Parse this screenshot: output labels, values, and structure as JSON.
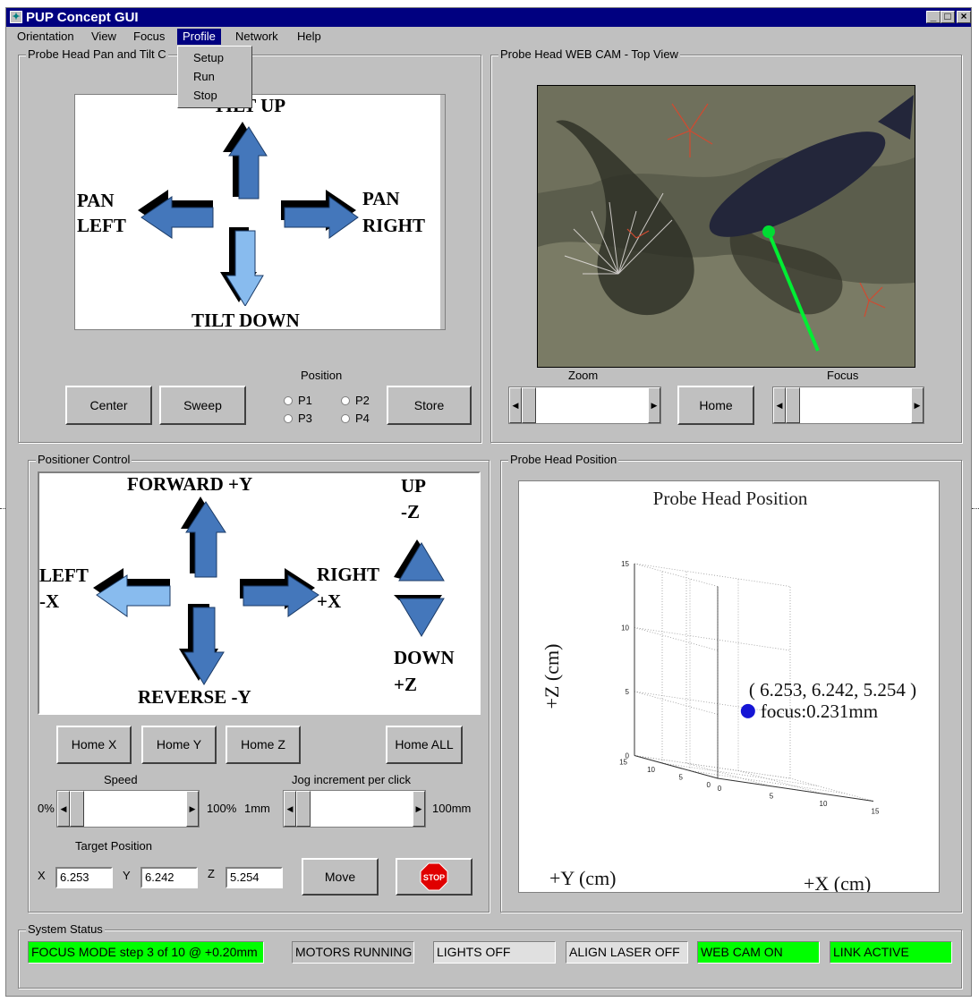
{
  "window": {
    "title": "PUP Concept GUI"
  },
  "menus": [
    "Orientation",
    "View",
    "Focus",
    "Profile",
    "Network",
    "Help"
  ],
  "profile_menu": [
    "Setup",
    "Run",
    "Stop"
  ],
  "pan_tilt": {
    "group_label": "Probe Head Pan and Tilt C",
    "tilt_up": "TILT UP",
    "tilt_down": "TILT DOWN",
    "pan_left": [
      "PAN",
      "LEFT"
    ],
    "pan_right": [
      "PAN",
      "RIGHT"
    ],
    "center_label": "Center",
    "sweep_label": "Sweep",
    "position_label": "Position",
    "presets": [
      "P1",
      "P2",
      "P3",
      "P4"
    ],
    "store_label": "Store"
  },
  "webcam": {
    "group_label": "Probe Head WEB CAM - Top View",
    "zoom_label": "Zoom",
    "focus_label": "Focus",
    "home_label": "Home"
  },
  "positioner": {
    "group_label": "Positioner Control",
    "forward": "FORWARD +Y",
    "reverse": "REVERSE -Y",
    "left": [
      "LEFT",
      "-X"
    ],
    "right": [
      "RIGHT",
      "+X"
    ],
    "up": [
      "UP",
      "-Z"
    ],
    "down": [
      "DOWN",
      "+Z"
    ],
    "home_buttons": [
      "Home X",
      "Home Y",
      "Home Z"
    ],
    "home_all_label": "Home ALL",
    "speed_label": "Speed",
    "speed_min": "0%",
    "speed_max": "100%",
    "jog_label": "Jog increment per click",
    "jog_min": "1mm",
    "jog_max": "100mm",
    "target_label": "Target Position",
    "target": {
      "x_label": "X",
      "y_label": "Y",
      "z_label": "Z",
      "x": "6.253",
      "y": "6.242",
      "z": "5.254"
    },
    "move_label": "Move",
    "stop_label": "STOP"
  },
  "probe_position": {
    "group_label": "Probe Head Position",
    "plot_title": "Probe Head Position",
    "ylabel": "+Y (cm)",
    "xlabel": "+X (cm)",
    "zlabel": "+Z (cm)",
    "annotation": "( 6.253, 6.242, 5.254 )",
    "focus_text": "focus:0.231mm",
    "z_ticks": [
      "0",
      "5",
      "10",
      "15"
    ],
    "y_ticks": [
      "15",
      "10",
      "5",
      "0"
    ],
    "x_ticks": [
      "0",
      "5",
      "10",
      "15"
    ]
  },
  "chart_data": {
    "type": "scatter",
    "title": "Probe Head Position",
    "xlabel": "+X (cm)",
    "ylabel": "+Y (cm)",
    "zlabel": "+Z (cm)",
    "xlim": [
      0,
      15
    ],
    "ylim": [
      0,
      15
    ],
    "zlim": [
      0,
      15
    ],
    "grid": true,
    "points": [
      {
        "x": 6.253,
        "y": 6.242,
        "z": 5.254
      }
    ],
    "annotations": [
      "( 6.253, 6.242, 5.254 )",
      "focus:0.231mm"
    ]
  },
  "system_status": {
    "group_label": "System Status",
    "items": [
      {
        "text": "FOCUS MODE step 3 of 10 @ +0.20mm",
        "color": "#00ff00"
      },
      {
        "text": "MOTORS RUNNING",
        "color": "#c0c0c0"
      },
      {
        "text": "LIGHTS OFF",
        "color": "#e0e0e0"
      },
      {
        "text": "ALIGN LASER OFF",
        "color": "#e0e0e0"
      },
      {
        "text": "WEB CAM ON",
        "color": "#00ff00"
      },
      {
        "text": "LINK ACTIVE",
        "color": "#00ff00"
      }
    ]
  }
}
